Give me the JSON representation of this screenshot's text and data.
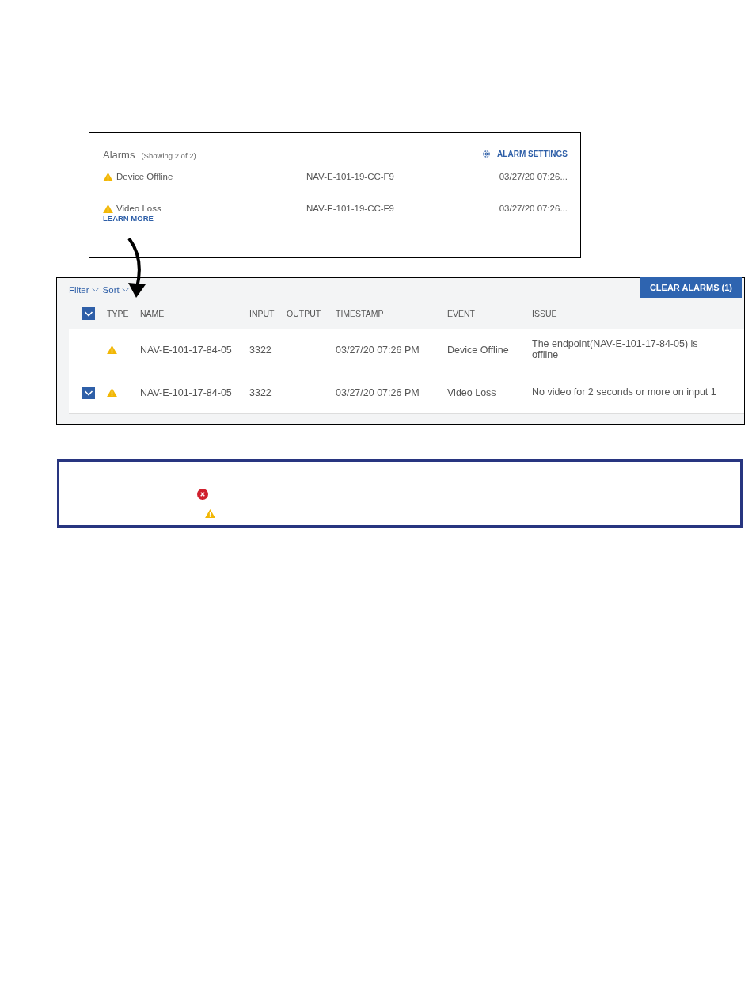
{
  "alarms_panel": {
    "title": "Alarms",
    "count": "(Showing 2 of 2)",
    "settings_link": "ALARM SETTINGS",
    "items": [
      {
        "kind": "warning",
        "event": "Device Offline",
        "device": "NAV-E-101-19-CC-F9",
        "time": "03/27/20 07:26..."
      },
      {
        "kind": "warning",
        "event": "Video Loss",
        "device": "NAV-E-101-19-CC-F9",
        "time": "03/27/20 07:26...",
        "link": "LEARN MORE"
      }
    ]
  },
  "alarms_table": {
    "filter": "Filter",
    "sort": "Sort",
    "clear_button": "CLEAR ALARMS (1)",
    "header_checked": true,
    "columns": [
      "TYPE",
      "NAME",
      "INPUT",
      "OUTPUT",
      "TIMESTAMP",
      "EVENT",
      "ISSUE"
    ],
    "rows": [
      {
        "checked": false,
        "kind": "warning",
        "name": "NAV-E-101-17-84-05",
        "input": "3322",
        "timestamp": "03/27/20 07:26 PM",
        "event": "Device Offline",
        "issue": "The endpoint(NAV-E-101-17-84-05) is offline"
      },
      {
        "checked": true,
        "kind": "warning",
        "name": "NAV-E-101-17-84-05",
        "input": "3322",
        "timestamp": "03/27/20 07:26 PM",
        "event": "Video Loss",
        "issue": "No video for 2 seconds or more on input 1"
      }
    ]
  },
  "note": {
    "icons": [
      {
        "kind": "error"
      },
      {
        "kind": "warning"
      }
    ]
  }
}
